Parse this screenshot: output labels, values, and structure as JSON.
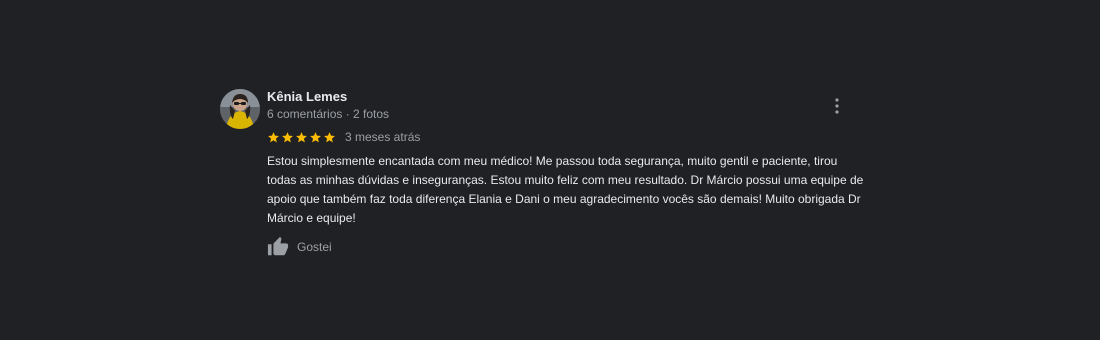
{
  "review": {
    "author": "Kênia Lemes",
    "meta": "6 comentários · 2 fotos",
    "rating": 5,
    "rating_max": 5,
    "time": "3 meses atrás",
    "text": "Estou simplesmente encantada com meu médico! Me passou toda segurança, muito gentil e paciente, tirou todas as minhas dúvidas e inseguranças. Estou muito feliz com meu resultado. Dr Márcio possui uma equipe de apoio que também faz toda diferença Elania e Dani o meu agradecimento vocês são demais! Muito obrigada Dr Márcio e equipe!",
    "like_label": "Gostei"
  },
  "colors": {
    "background": "#202124",
    "star": "#fbbc04",
    "primary_text": "#e8eaed",
    "secondary_text": "#9aa0a6"
  },
  "icons": {
    "more": "more-vert-icon",
    "like": "thumb-up-icon",
    "star": "star-icon"
  }
}
